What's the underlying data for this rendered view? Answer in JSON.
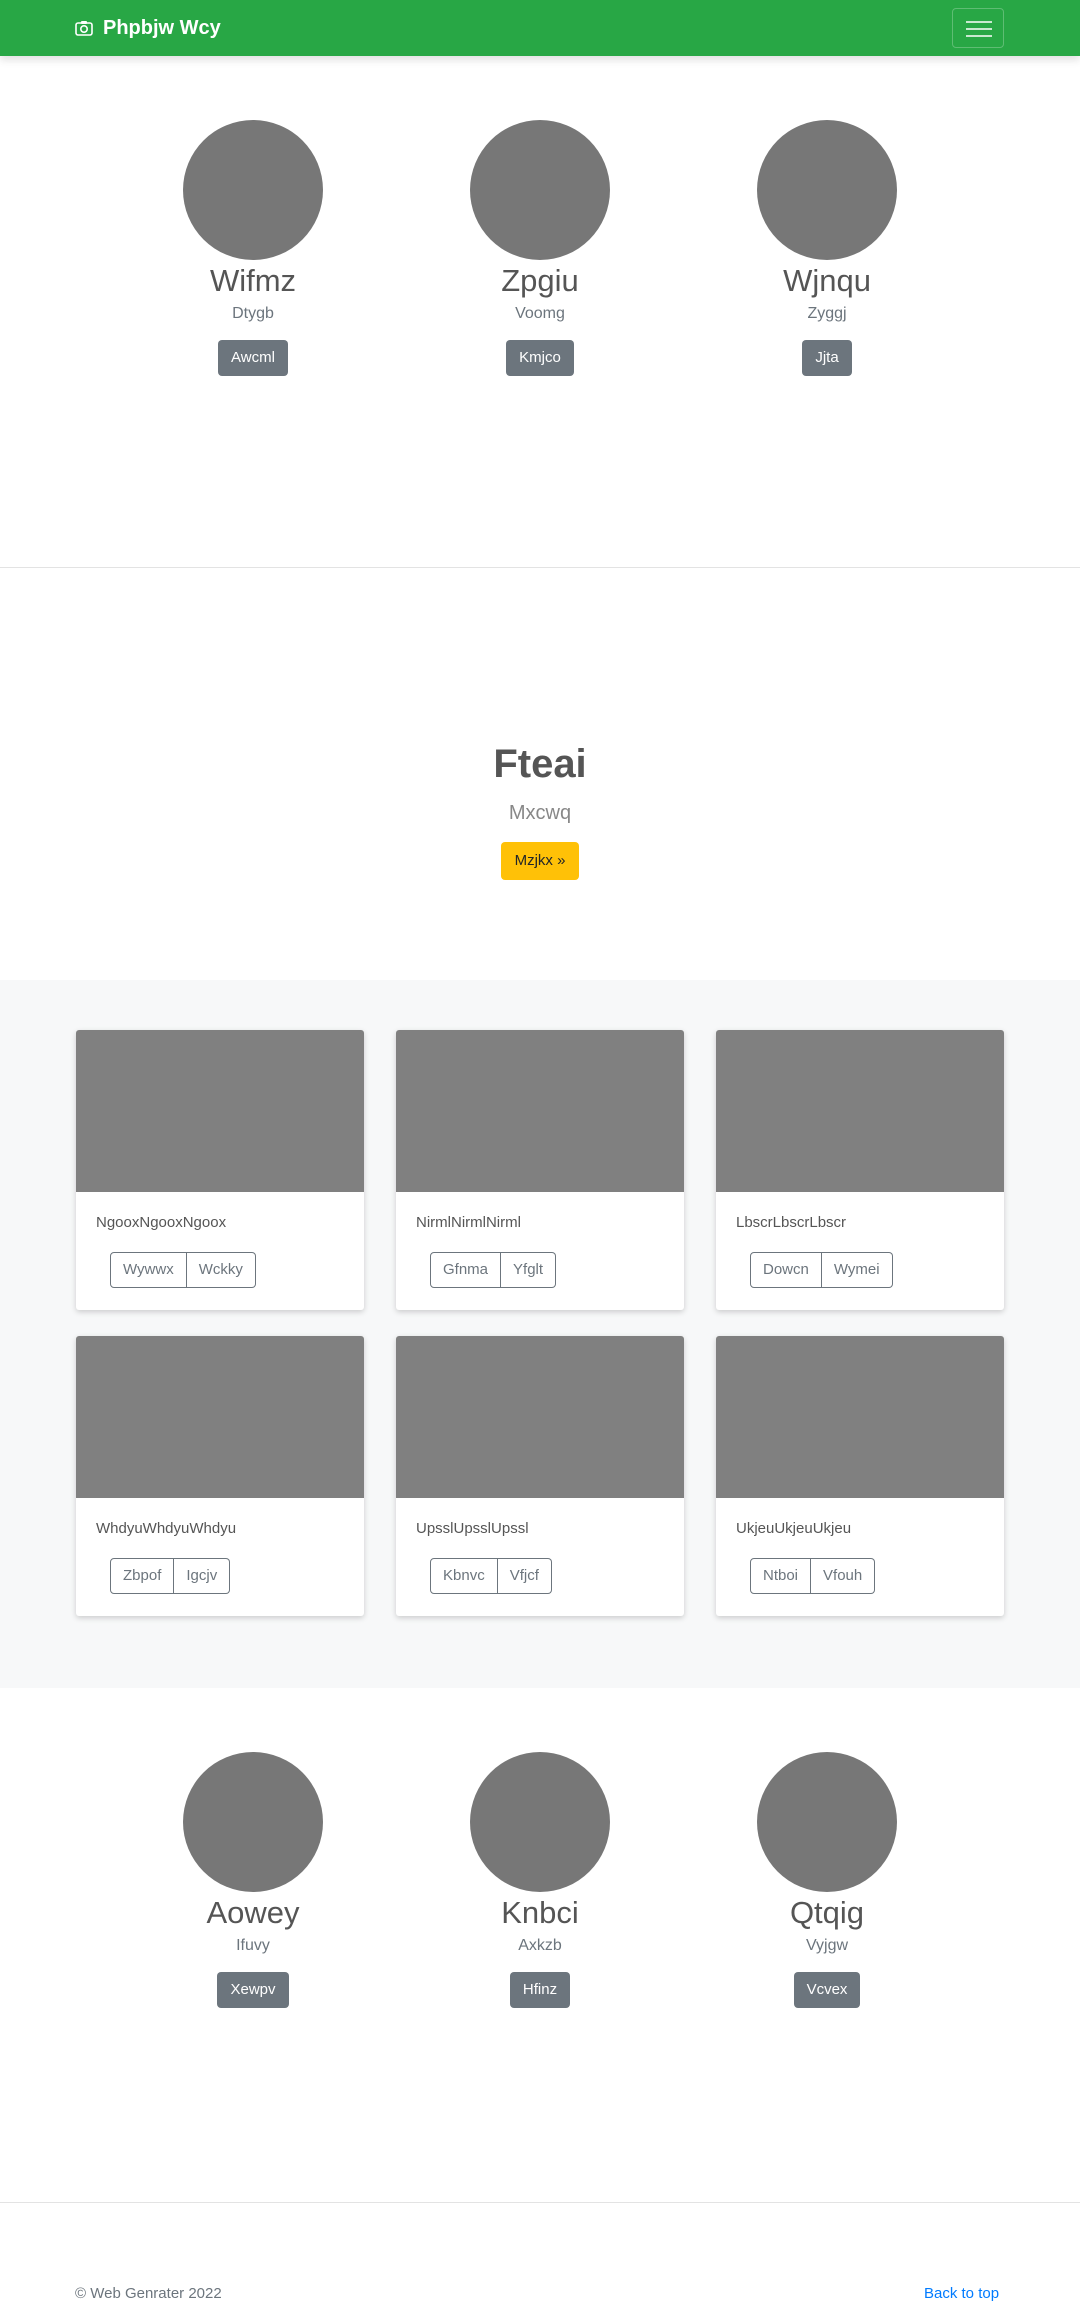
{
  "navbar": {
    "brand": "Phpbjw Wcy",
    "brand_icon": "camera-icon",
    "menu_icon": "hamburger-menu-icon",
    "bg_color": "#28a745"
  },
  "team_top": [
    {
      "name": "Wifmz",
      "role": "Dtygb",
      "button": "Awcml"
    },
    {
      "name": "Zpgiu",
      "role": "Voomg",
      "button": "Kmjco"
    },
    {
      "name": "Wjnqu",
      "role": "Zyggj",
      "button": "Jjta"
    }
  ],
  "hero": {
    "title": "Fteai",
    "subtitle": "Mxcwq",
    "button": "Mzjkx »",
    "button_color": "#ffc107"
  },
  "cards": [
    {
      "text": "NgooxNgooxNgoox",
      "btn1": "Wywwx",
      "btn2": "Wckky"
    },
    {
      "text": "NirmlNirmlNirml",
      "btn1": "Gfnma",
      "btn2": "Yfglt"
    },
    {
      "text": "LbscrLbscrLbscr",
      "btn1": "Dowcn",
      "btn2": "Wymei"
    },
    {
      "text": "WhdyuWhdyuWhdyu",
      "btn1": "Zbpof",
      "btn2": "Igcjv"
    },
    {
      "text": "UpsslUpsslUpssl",
      "btn1": "Kbnvc",
      "btn2": "Vfjcf"
    },
    {
      "text": "UkjeuUkjeuUkjeu",
      "btn1": "Ntboi",
      "btn2": "Vfouh"
    }
  ],
  "team_bottom": [
    {
      "name": "Aowey",
      "role": "Ifuvy",
      "button": "Xewpv"
    },
    {
      "name": "Knbci",
      "role": "Axkzb",
      "button": "Hfinz"
    },
    {
      "name": "Qtqig",
      "role": "Vyjgw",
      "button": "Vcvex"
    }
  ],
  "footer": {
    "copyright": "© Web Genrater 2022",
    "back_to_top": "Back to top"
  }
}
